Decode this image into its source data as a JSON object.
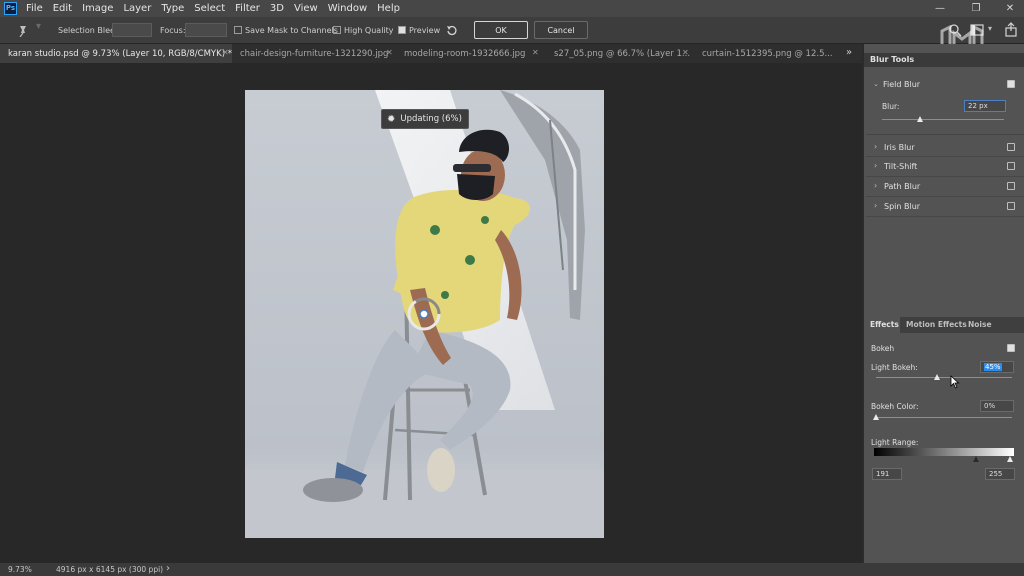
{
  "menu": {
    "logo": "Ps",
    "items": [
      "File",
      "Edit",
      "Image",
      "Layer",
      "Type",
      "Select",
      "Filter",
      "3D",
      "View",
      "Window",
      "Help"
    ]
  },
  "options": {
    "selection_bleed_label": "Selection Bleed:",
    "focus_label": "Focus:",
    "save_mask_label": "Save Mask to Channels",
    "save_mask_checked": false,
    "high_quality_label": "High Quality",
    "high_quality_checked": false,
    "preview_label": "Preview",
    "preview_checked": true,
    "ok_label": "OK",
    "cancel_label": "Cancel"
  },
  "tabs": [
    {
      "label": "karan studio.psd @ 9.73% (Layer 10, RGB/8/CMYK) *",
      "active": true
    },
    {
      "label": "chair-design-furniture-1321290.jpg",
      "active": false
    },
    {
      "label": "modeling-room-1932666.jpg",
      "active": false
    },
    {
      "label": "s27_05.png @ 66.7% (Layer 1...",
      "active": false
    },
    {
      "label": "curtain-1512395.png @ 12.5...",
      "active": false
    }
  ],
  "tab_overflow": "»",
  "canvas": {
    "updating_label": "Updating (6%)"
  },
  "status": {
    "zoom": "9.73%",
    "dimensions": "4916 px x 6145 px (300 ppi)",
    "arrow": "›"
  },
  "blur_tools": {
    "title": "Blur Tools",
    "field_blur": {
      "label": "Field Blur",
      "checked": true,
      "blur_label": "Blur:",
      "blur_value": "22 px",
      "slider_fraction": 0.45
    },
    "others": [
      {
        "label": "Iris Blur",
        "checked": false
      },
      {
        "label": "Tilt-Shift",
        "checked": false
      },
      {
        "label": "Path Blur",
        "checked": false
      },
      {
        "label": "Spin Blur",
        "checked": false
      }
    ]
  },
  "effects": {
    "tabs": [
      "Effects",
      "Motion Effects",
      "Noise"
    ],
    "active_tab": "Effects",
    "bokeh_label": "Bokeh",
    "bokeh_checked": true,
    "light_bokeh_label": "Light Bokeh:",
    "light_bokeh_value": "45%",
    "light_bokeh_fraction": 0.45,
    "bokeh_color_label": "Bokeh Color:",
    "bokeh_color_value": "0%",
    "bokeh_color_fraction": 0.0,
    "light_range_label": "Light Range:",
    "light_range_low": "191",
    "light_range_high": "255"
  },
  "colors": {
    "accent": "#2d8ceb",
    "panel_bg": "#535353",
    "canvas_bg": "#282828"
  }
}
